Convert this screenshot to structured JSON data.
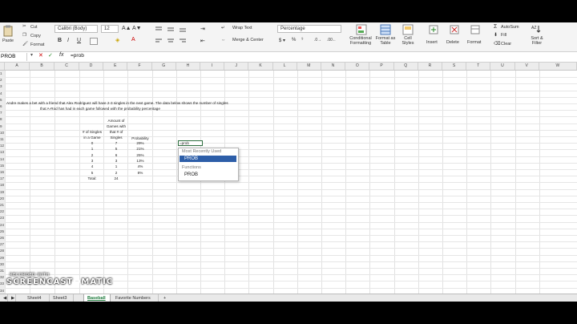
{
  "ribbon": {
    "paste": "Paste",
    "cut": "Cut",
    "copy": "Copy",
    "format": "Format",
    "font_name": "Calibri (Body)",
    "font_size": "12",
    "wrap_text": "Wrap Text",
    "merge_center": "Merge & Center",
    "number_format": "Percentage",
    "conditional_formatting": "Conditional Formatting",
    "format_as_table": "Format as Table",
    "cell_styles": "Cell Styles",
    "insert": "Insert",
    "delete": "Delete",
    "format_cells": "Format",
    "autosum": "AutoSum",
    "fill": "Fill",
    "clear": "Clear",
    "sort_filter": "Sort & Filter"
  },
  "formula_bar": {
    "name_box": "PROB",
    "fx": "fx",
    "formula": "=prob"
  },
  "columns": [
    "A",
    "B",
    "C",
    "D",
    "E",
    "F",
    "G",
    "H",
    "I",
    "J",
    "K",
    "L",
    "M",
    "N",
    "O",
    "P",
    "Q",
    "R",
    "S",
    "T",
    "U",
    "V",
    "W"
  ],
  "rows": [
    "1",
    "2",
    "3",
    "4",
    "5",
    "6",
    "7",
    "8",
    "9",
    "10",
    "11",
    "12",
    "13",
    "14",
    "15",
    "16",
    "17",
    "18",
    "19",
    "20",
    "21",
    "22",
    "23",
    "24",
    "25",
    "26",
    "27",
    "28",
    "29",
    "30",
    "31",
    "32",
    "33",
    "34",
    "35"
  ],
  "sheet": {
    "intro_line1": "Andre makes a bet with a friend that Alex Rodriguez will have 2-3 singles in the next game. The data below shows the number of singles",
    "intro_line2": "that A-Rod has had in each game followed with the probability percentage",
    "header_d": [
      "# of Singles",
      "in a Game"
    ],
    "header_e": [
      "Amount of",
      "Games with",
      "that # of",
      "Singles"
    ],
    "header_f": "Probability",
    "singles": [
      "0",
      "1",
      "2",
      "3",
      "4",
      "5"
    ],
    "games": [
      "7",
      "5",
      "6",
      "3",
      "1",
      "2"
    ],
    "probabilities": [
      "29%",
      "21%",
      "25%",
      "13%",
      "4%",
      "8%"
    ],
    "total_label": "Total:",
    "total_value": "24",
    "editing_cell": "=prob"
  },
  "autocomplete": {
    "recent_header": "Most Recently Used",
    "recent_item": "PROB",
    "functions_header": "Functions",
    "function_item": "PROB"
  },
  "tabs": [
    "Sheet4",
    "Sheet3",
    "Baseball",
    "Favorite Numbers",
    "+"
  ],
  "watermark": {
    "line1": "RECORDED WITH",
    "line2": "SCREENCAST",
    "line3": "MATIC"
  },
  "colors": {
    "selection": "#2d5ea8",
    "active_tab": "#1e7a3c"
  }
}
